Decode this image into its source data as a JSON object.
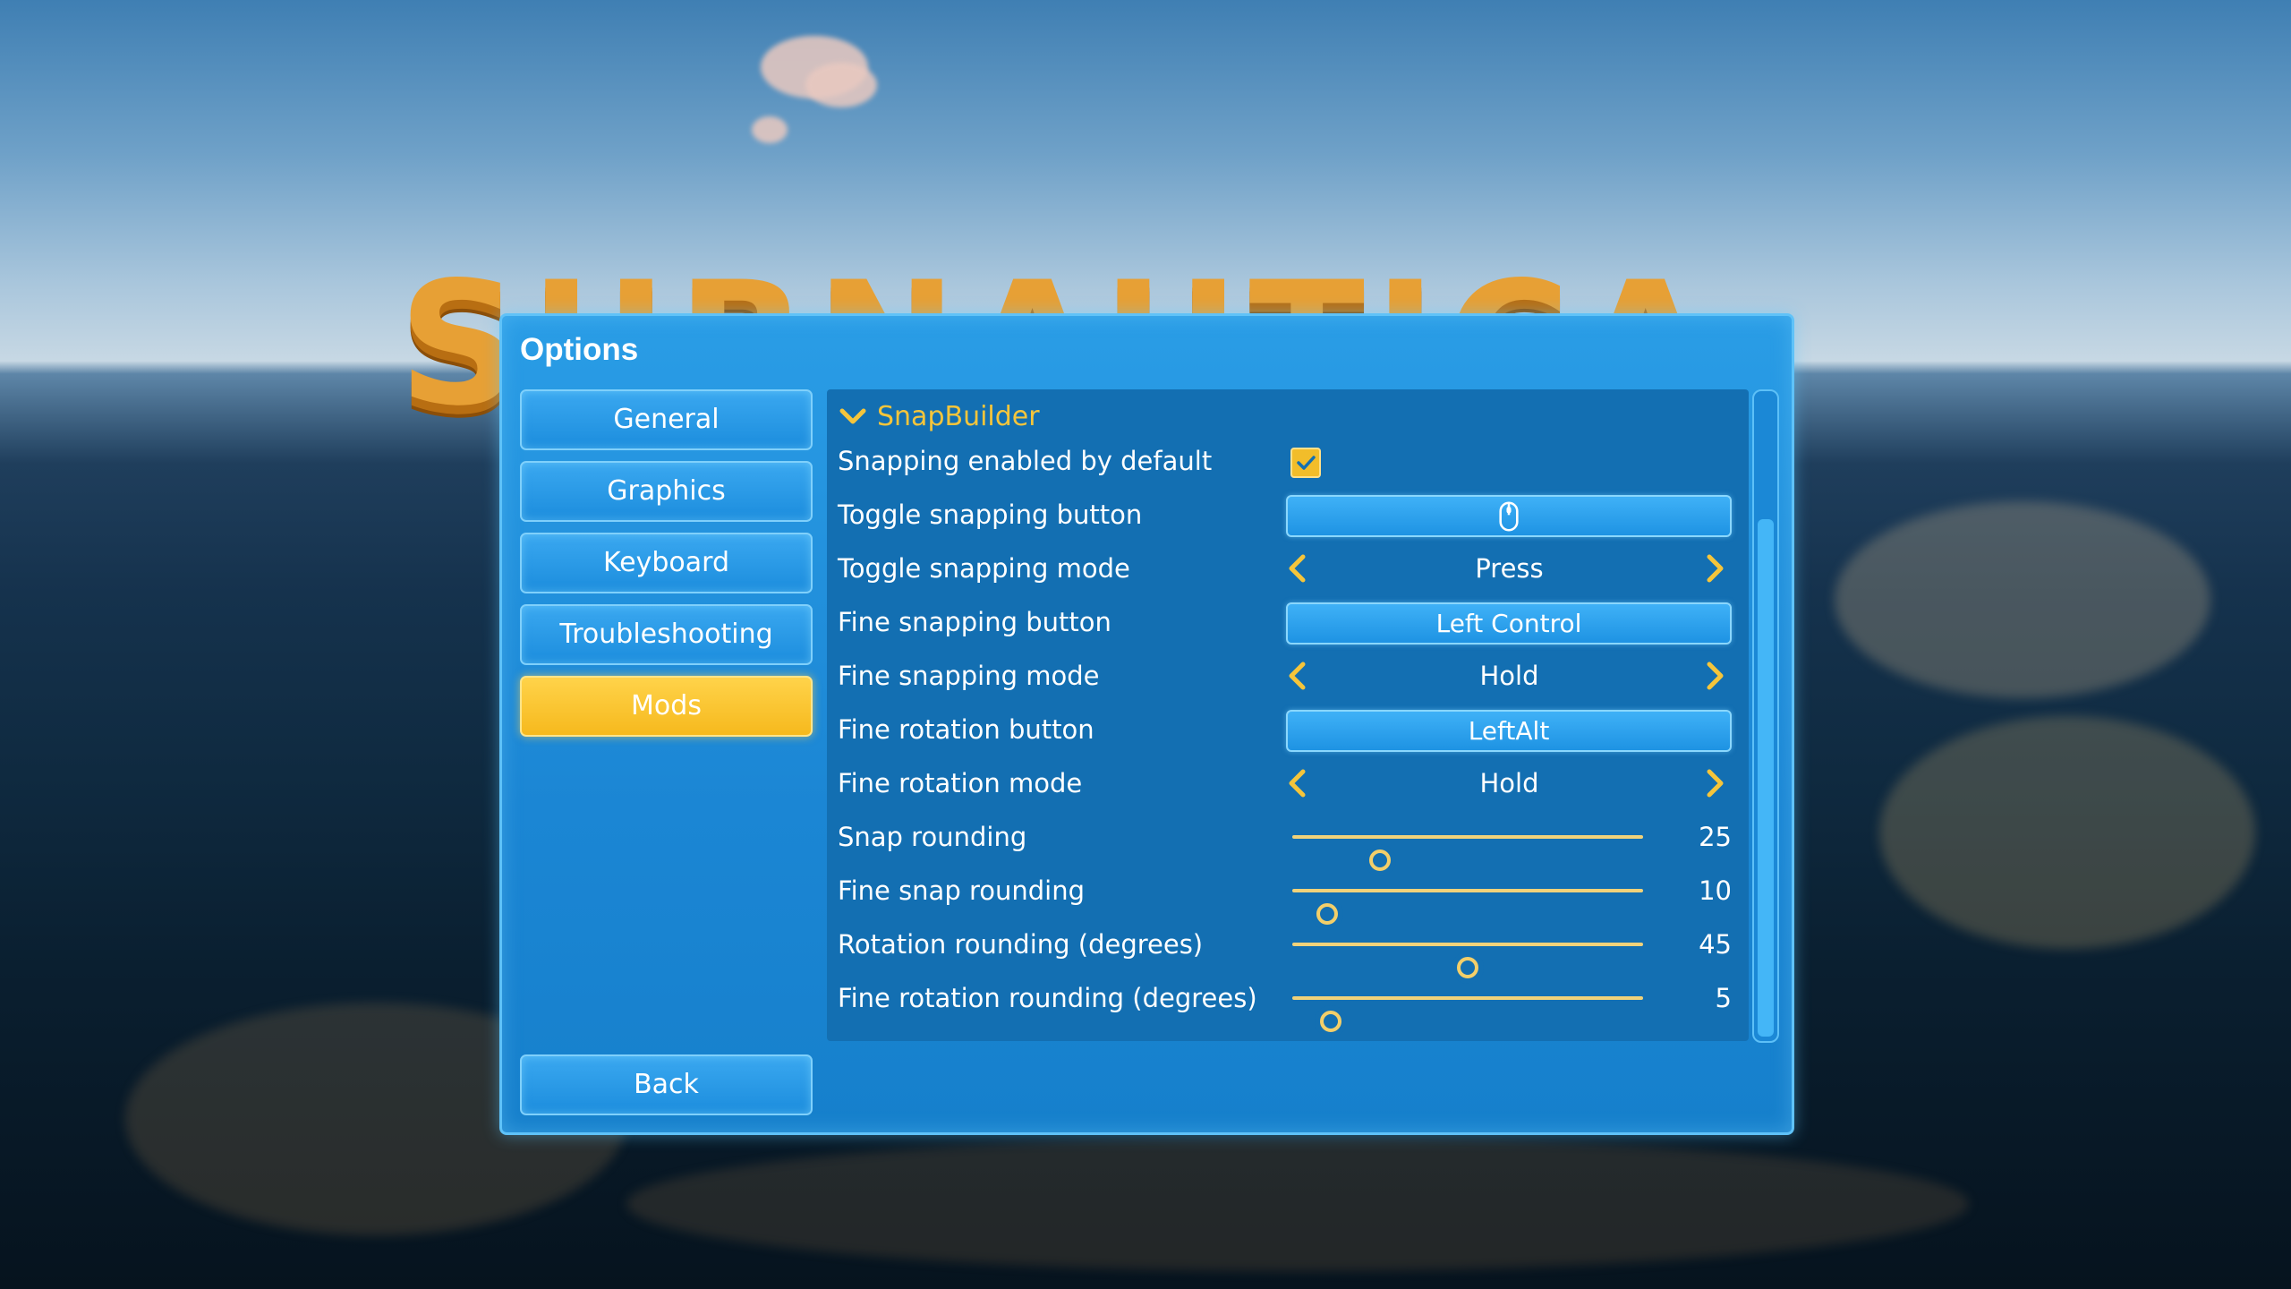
{
  "logo_text": "SUBNAUTICA",
  "dialog": {
    "title": "Options"
  },
  "tabs": [
    {
      "label": "General",
      "active": false
    },
    {
      "label": "Graphics",
      "active": false
    },
    {
      "label": "Keyboard",
      "active": false
    },
    {
      "label": "Troubleshooting",
      "active": false
    },
    {
      "label": "Mods",
      "active": true
    }
  ],
  "back_label": "Back",
  "section": {
    "title": "SnapBuilder",
    "expanded": true
  },
  "settings": {
    "snapping_enabled": {
      "label": "Snapping enabled by default",
      "checked": true
    },
    "toggle_snapping_button": {
      "label": "Toggle snapping button",
      "value_icon": "mouse-middle-icon"
    },
    "toggle_snapping_mode": {
      "label": "Toggle snapping mode",
      "value": "Press"
    },
    "fine_snapping_button": {
      "label": "Fine snapping button",
      "value": "Left Control"
    },
    "fine_snapping_mode": {
      "label": "Fine snapping mode",
      "value": "Hold"
    },
    "fine_rotation_button": {
      "label": "Fine rotation button",
      "value": "LeftAlt"
    },
    "fine_rotation_mode": {
      "label": "Fine rotation mode",
      "value": "Hold"
    },
    "snap_rounding": {
      "label": "Snap rounding",
      "value": "25",
      "fraction": 0.25
    },
    "fine_snap_rounding": {
      "label": "Fine snap rounding",
      "value": "10",
      "fraction": 0.1
    },
    "rotation_rounding": {
      "label": "Rotation rounding (degrees)",
      "value": "45",
      "fraction": 0.5
    },
    "fine_rotation_rounding": {
      "label": "Fine rotation rounding (degrees)",
      "value": "5",
      "fraction": 0.11
    }
  },
  "colors": {
    "accent_yellow": "#f5c53b",
    "panel_blue": "#136fb2",
    "dialog_blue": "#1b86d4"
  }
}
